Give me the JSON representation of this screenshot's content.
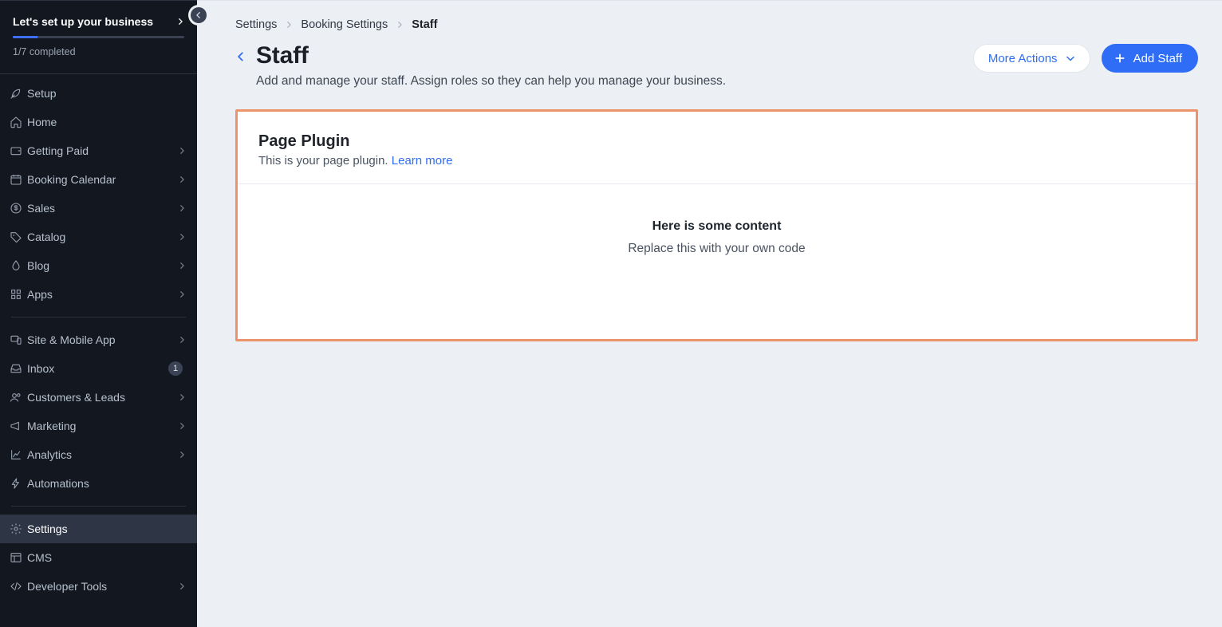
{
  "setup_banner": {
    "title": "Let's set up your business",
    "completed": "1/7 completed"
  },
  "sidebar": {
    "groups": [
      [
        {
          "icon": "rocket",
          "label": "Setup",
          "chev": false
        },
        {
          "icon": "home",
          "label": "Home",
          "chev": false
        },
        {
          "icon": "wallet",
          "label": "Getting Paid",
          "chev": true
        },
        {
          "icon": "calendar",
          "label": "Booking Calendar",
          "chev": true
        },
        {
          "icon": "dollar",
          "label": "Sales",
          "chev": true
        },
        {
          "icon": "tag",
          "label": "Catalog",
          "chev": true
        },
        {
          "icon": "drop",
          "label": "Blog",
          "chev": true
        },
        {
          "icon": "grid",
          "label": "Apps",
          "chev": true
        }
      ],
      [
        {
          "icon": "devices",
          "label": "Site & Mobile App",
          "chev": true
        },
        {
          "icon": "inbox",
          "label": "Inbox",
          "chev": false,
          "badge": "1"
        },
        {
          "icon": "users",
          "label": "Customers & Leads",
          "chev": true
        },
        {
          "icon": "megaphone",
          "label": "Marketing",
          "chev": true
        },
        {
          "icon": "chart",
          "label": "Analytics",
          "chev": true
        },
        {
          "icon": "bolt",
          "label": "Automations",
          "chev": false
        }
      ],
      [
        {
          "icon": "gear",
          "label": "Settings",
          "chev": false,
          "active": true
        },
        {
          "icon": "layout",
          "label": "CMS",
          "chev": false
        },
        {
          "icon": "code",
          "label": "Developer Tools",
          "chev": true
        }
      ]
    ]
  },
  "breadcrumb": {
    "items": [
      "Settings",
      "Booking Settings",
      "Staff"
    ]
  },
  "page": {
    "title": "Staff",
    "subtitle": "Add and manage your staff. Assign roles so they can help you manage your business.",
    "more_actions": "More Actions",
    "add_staff": "Add Staff"
  },
  "plugin": {
    "title": "Page Plugin",
    "subtitle_prefix": "This is your page plugin.  ",
    "learn_more": "Learn more",
    "content_heading": "Here is some content",
    "content_text": "Replace this with your own code"
  }
}
